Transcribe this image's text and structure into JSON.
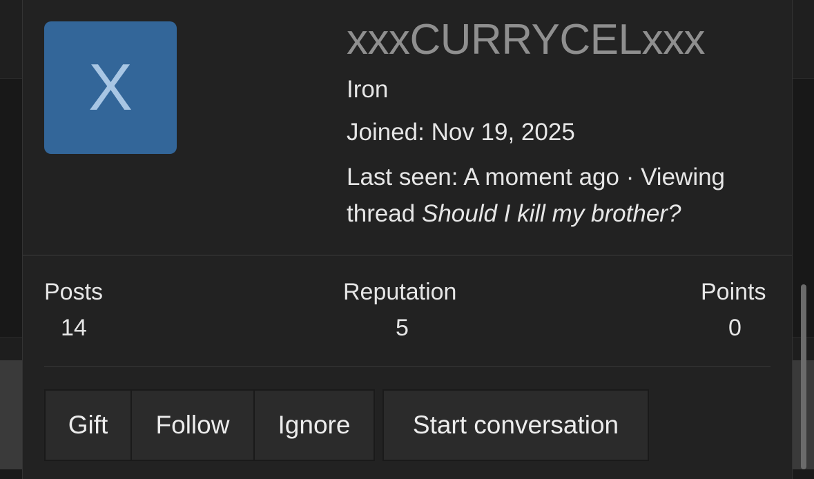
{
  "profile": {
    "avatar_letter": "X",
    "avatar_color": "#336699",
    "username": "xxxCURRYCELxxx",
    "rank": "Iron",
    "joined": "Joined: Nov 19, 2025",
    "last_seen_prefix": "Last seen: A moment ago · Viewing",
    "last_seen_thread_word": "thread ",
    "last_seen_thread_title": "Should I kill my brother?"
  },
  "stats": {
    "posts_label": "Posts",
    "posts_value": "14",
    "reputation_label": "Reputation",
    "reputation_value": "5",
    "points_label": "Points",
    "points_value": "0"
  },
  "actions": {
    "gift": "Gift",
    "follow": "Follow",
    "ignore": "Ignore",
    "start_conversation": "Start conversation"
  }
}
